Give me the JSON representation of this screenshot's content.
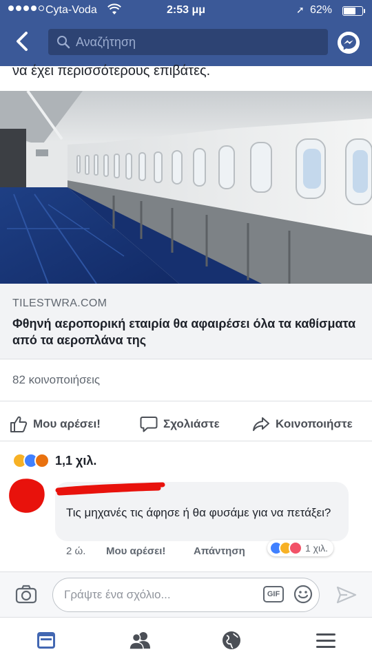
{
  "status_bar": {
    "carrier": "Cyta-Voda",
    "time": "2:53 μμ",
    "battery": "62%",
    "battery_level": 0.62
  },
  "nav": {
    "search_placeholder": "Αναζήτηση",
    "icons": [
      "back-chevron-icon",
      "search-icon",
      "messenger-icon"
    ]
  },
  "post": {
    "text_fragment": "να έχει περισσότερους επιβάτες.",
    "link": {
      "domain": "TILESTWRA.COM",
      "headline": "Φθηνή αεροπορική εταιρία θα αφαιρέσει όλα τα καθίσματα από τα αεροπλάνα της"
    },
    "shares": "82 κοινοποιήσεις",
    "actions": {
      "like": "Μου αρέσει!",
      "comment": "Σχολιάστε",
      "share": "Κοινοποιήστε"
    },
    "reactions_count": "1,1 χιλ.",
    "reaction_types": [
      "haha",
      "like",
      "angry"
    ]
  },
  "comment": {
    "text": "Τις μηχανές τις άφησε ή θα φυσάμε για να πετάξει?",
    "time": "2 ώ.",
    "like_label": "Μου αρέσει!",
    "reply_label": "Απάντηση",
    "reactions_count": "1 χιλ.",
    "reaction_types": [
      "like",
      "haha",
      "love"
    ]
  },
  "composer": {
    "placeholder": "Γράψτε ένα σχόλιο...",
    "gif_label": "GIF"
  },
  "colors": {
    "brand": "#3b5998",
    "scribble": "#e8120c"
  }
}
